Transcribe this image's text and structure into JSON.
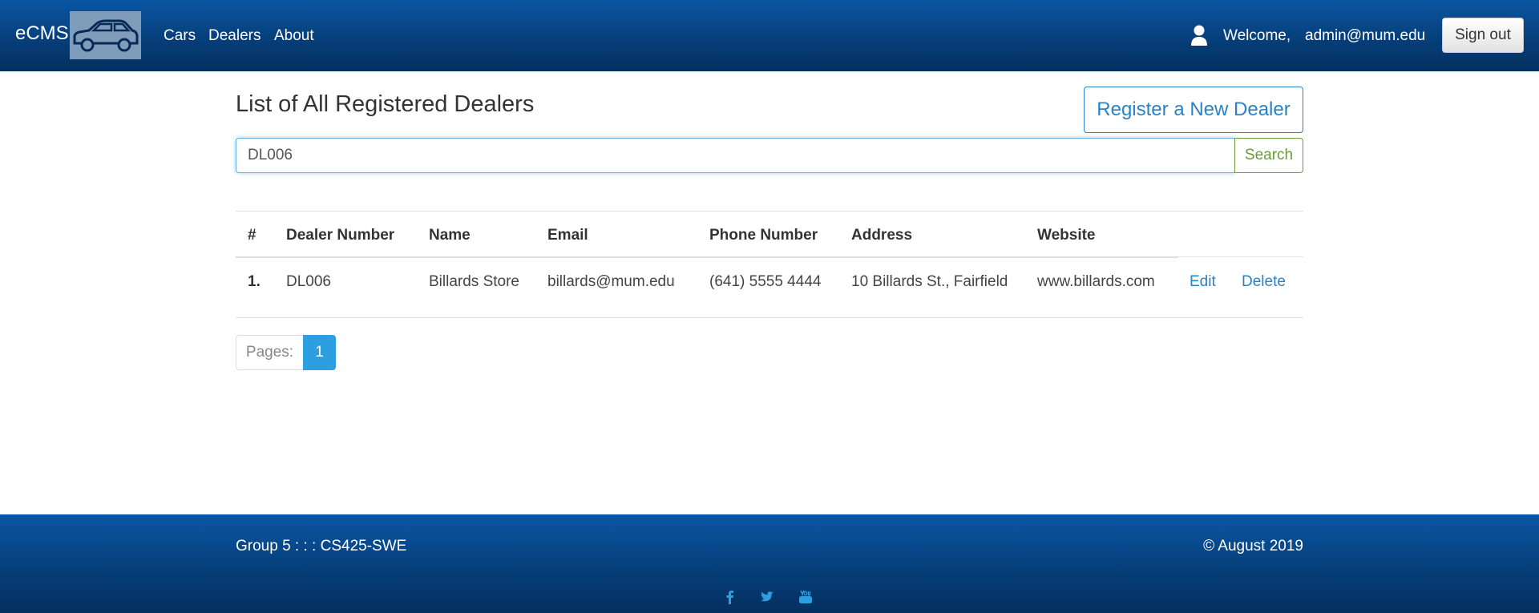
{
  "navbar": {
    "brand": "eCMS",
    "logo_icon": "car-icon",
    "links": [
      "Cars",
      "Dealers",
      "About"
    ],
    "user_icon": "user-icon",
    "welcome": "Welcome,",
    "user_email": "admin@mum.edu",
    "signout_label": "Sign out"
  },
  "main": {
    "title": "List of All Registered Dealers",
    "register_label": "Register a New Dealer",
    "search": {
      "value": "DL006",
      "button_label": "Search"
    },
    "table": {
      "headers": [
        "#",
        "Dealer Number",
        "Name",
        "Email",
        "Phone Number",
        "Address",
        "Website"
      ],
      "rows": [
        {
          "index": "1.",
          "dealer_number": "DL006",
          "name": "Billards Store",
          "email": "billards@mum.edu",
          "phone": "(641) 5555 4444",
          "address": "10 Billards St., Fairfield",
          "website": "www.billards.com",
          "edit_label": "Edit",
          "delete_label": "Delete"
        }
      ]
    },
    "pagination": {
      "label": "Pages:",
      "pages": [
        "1"
      ],
      "current": "1"
    }
  },
  "footer": {
    "left": "Group 5 : : : CS425-SWE",
    "right": "© August 2019",
    "social_icons": [
      "facebook-icon",
      "twitter-icon",
      "youtube-icon"
    ]
  },
  "colors": {
    "nav_bg": "#063d77",
    "link_blue": "#2a82c6",
    "search_green": "#6a9a3a",
    "page_active": "#2d9fe0"
  }
}
